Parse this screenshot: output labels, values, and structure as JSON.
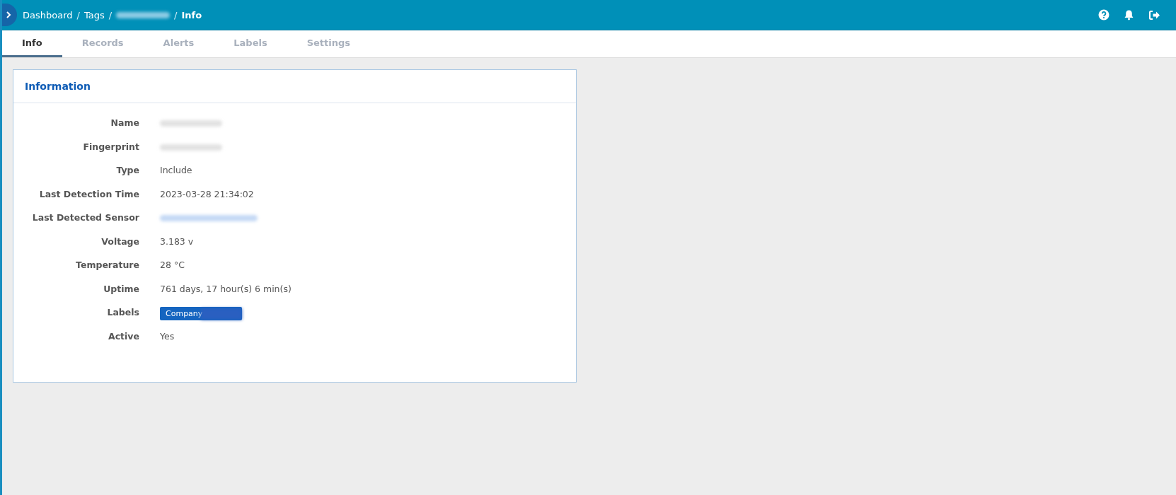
{
  "breadcrumb": [
    {
      "kind": "link",
      "label": "Dashboard",
      "separator": "/"
    },
    {
      "kind": "link",
      "label": "Tags",
      "separator": "/"
    },
    {
      "kind": "redacted",
      "separator": "/"
    },
    {
      "kind": "current",
      "label": "Info"
    }
  ],
  "tabs": [
    {
      "label": "Info",
      "selected": true
    },
    {
      "label": "Records",
      "selected": false
    },
    {
      "label": "Alerts",
      "selected": false
    },
    {
      "label": "Labels",
      "selected": false
    },
    {
      "label": "Settings",
      "selected": false
    }
  ],
  "card": {
    "title": "Information",
    "fields": [
      {
        "label": "Name",
        "kind": "redacted"
      },
      {
        "label": "Fingerprint",
        "kind": "redacted"
      },
      {
        "label": "Type",
        "kind": "text",
        "value": "Include"
      },
      {
        "label": "Last Detection Time",
        "kind": "text",
        "value": "2023-03-28 21:34:02"
      },
      {
        "label": "Last Detected Sensor",
        "kind": "redacted-link"
      },
      {
        "label": "Voltage",
        "kind": "text",
        "value": "3.183 v"
      },
      {
        "label": "Temperature",
        "kind": "text",
        "value": "28 °C"
      },
      {
        "label": "Uptime",
        "kind": "text",
        "value": "761 days, 17 hour(s) 6 min(s)"
      },
      {
        "label": "Labels",
        "kind": "badge",
        "value": "Company"
      },
      {
        "label": "Active",
        "kind": "text",
        "value": "Yes"
      }
    ]
  }
}
